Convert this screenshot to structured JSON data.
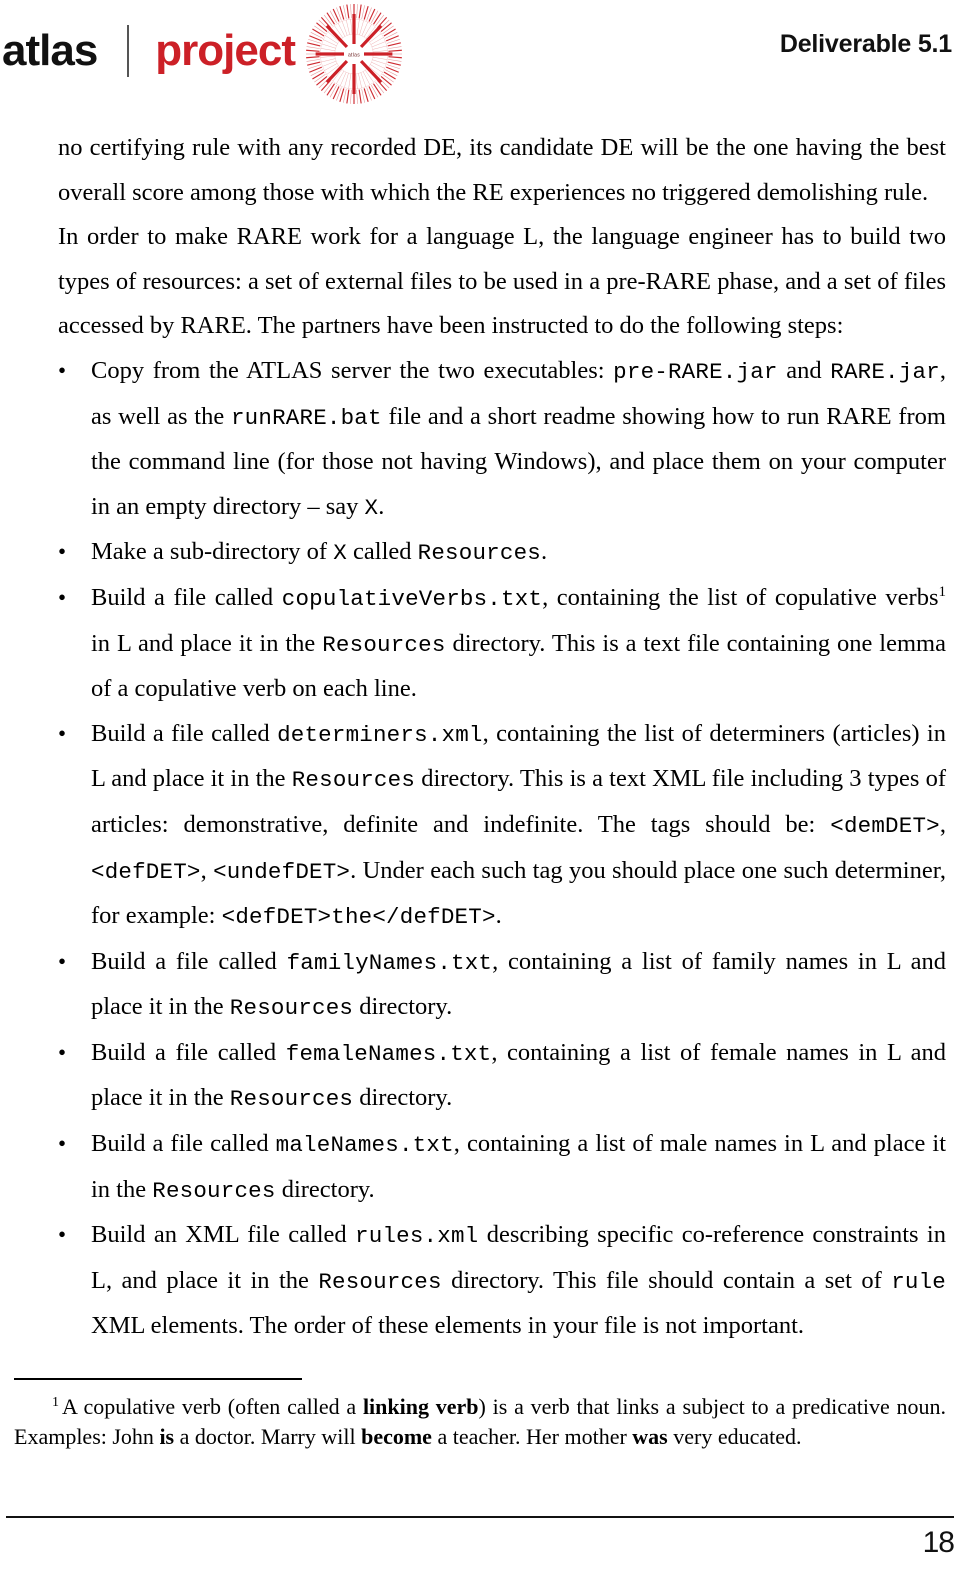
{
  "header": {
    "brand_atlas": "atlas",
    "brand_project": "project",
    "brand_mark_name": "atlas-radial-burst-logo",
    "brand_mark_center_text": "atlas",
    "deliverable": "Deliverable 5.1",
    "accent_red": "#cc2027",
    "text_black": "#111111"
  },
  "body": {
    "paragraph_continued": {
      "part1": "no certifying rule with any recorded DE, its candidate DE will be the one having the best overall score among those with which the RE experiences no triggered demolishing rule."
    },
    "paragraph_rare": {
      "part1": "In order to make RARE work for a language L, the language engineer has to build two types of resources: a set of external files to be used in a pre-RARE phase, and a set of files accessed by RARE. The partners have been instructed to do the following steps:"
    },
    "bullet_glyph": "•",
    "bullets": [
      {
        "name": "copy-executables",
        "segments": [
          {
            "type": "text",
            "value": "Copy from the ATLAS server the two executables: "
          },
          {
            "type": "mono",
            "value": "pre-RARE.jar"
          },
          {
            "type": "text",
            "value": " and "
          },
          {
            "type": "mono",
            "value": "RARE.jar"
          },
          {
            "type": "text",
            "value": ", as well as the "
          },
          {
            "type": "mono",
            "value": "runRARE.bat"
          },
          {
            "type": "text",
            "value": " file and a short readme showing how to run RARE from the command line (for those not having Windows), and place them on your computer in an empty directory – say "
          },
          {
            "type": "mono",
            "value": "X"
          },
          {
            "type": "text",
            "value": "."
          }
        ]
      },
      {
        "name": "make-resources-subdirectory",
        "segments": [
          {
            "type": "text",
            "value": "Make a sub-directory of "
          },
          {
            "type": "mono",
            "value": "X"
          },
          {
            "type": "text",
            "value": " called "
          },
          {
            "type": "mono",
            "value": "Resources"
          },
          {
            "type": "text",
            "value": "."
          }
        ]
      },
      {
        "name": "build-copulative-verbs-file",
        "segments": [
          {
            "type": "text",
            "value": "Build a file called "
          },
          {
            "type": "mono",
            "value": "copulativeVerbs.txt"
          },
          {
            "type": "text",
            "value": ", containing the list of copulative verbs"
          },
          {
            "type": "sup",
            "value": "1"
          },
          {
            "type": "text",
            "value": " in L and place it in the "
          },
          {
            "type": "mono",
            "value": "Resources"
          },
          {
            "type": "text",
            "value": " directory. This is a text file containing one lemma of a copulative verb on each line."
          }
        ]
      },
      {
        "name": "build-determiners-file",
        "segments": [
          {
            "type": "text",
            "value": "Build a file called "
          },
          {
            "type": "mono",
            "value": "determiners.xml"
          },
          {
            "type": "text",
            "value": ", containing the list of determiners (articles) in L and place it in the "
          },
          {
            "type": "mono",
            "value": "Resources"
          },
          {
            "type": "text",
            "value": " directory. This is a text XML file including 3 types of articles: demonstrative, definite and indefinite. The tags should be: "
          },
          {
            "type": "mono",
            "value": "<demDET>"
          },
          {
            "type": "text",
            "value": ", "
          },
          {
            "type": "mono",
            "value": "<defDET>"
          },
          {
            "type": "text",
            "value": ", "
          },
          {
            "type": "mono",
            "value": "<undefDET>"
          },
          {
            "type": "text",
            "value": ". Under each such tag you should place one such determiner, for example: "
          },
          {
            "type": "mono",
            "value": "<defDET>the</defDET>"
          },
          {
            "type": "text",
            "value": "."
          }
        ]
      },
      {
        "name": "build-family-names-file",
        "segments": [
          {
            "type": "text",
            "value": "Build a file called "
          },
          {
            "type": "mono",
            "value": "familyNames.txt"
          },
          {
            "type": "text",
            "value": ", containing a list of family names in L and place it in the "
          },
          {
            "type": "mono",
            "value": "Resources"
          },
          {
            "type": "text",
            "value": " directory."
          }
        ]
      },
      {
        "name": "build-female-names-file",
        "segments": [
          {
            "type": "text",
            "value": "Build a file called "
          },
          {
            "type": "mono",
            "value": "femaleNames.txt"
          },
          {
            "type": "text",
            "value": ", containing a list of female names in L and place it in the "
          },
          {
            "type": "mono",
            "value": "Resources"
          },
          {
            "type": "text",
            "value": " directory."
          }
        ]
      },
      {
        "name": "build-male-names-file",
        "segments": [
          {
            "type": "text",
            "value": "Build a file called "
          },
          {
            "type": "mono",
            "value": "maleNames.txt"
          },
          {
            "type": "text",
            "value": ", containing a list of male names in L and place it in the "
          },
          {
            "type": "mono",
            "value": "Resources"
          },
          {
            "type": "text",
            "value": " directory."
          }
        ]
      },
      {
        "name": "build-rules-xml-file",
        "segments": [
          {
            "type": "text",
            "value": "Build an XML file called "
          },
          {
            "type": "mono",
            "value": "rules.xml"
          },
          {
            "type": "text",
            "value": " describing specific co-reference constraints in L, and place it in the "
          },
          {
            "type": "mono",
            "value": "Resources"
          },
          {
            "type": "text",
            "value": " directory. This file should contain a set of "
          },
          {
            "type": "mono",
            "value": "rule"
          },
          {
            "type": "text",
            "value": " XML elements. The order of these elements in your file is not important."
          }
        ]
      }
    ]
  },
  "footnote": {
    "number": "1",
    "segments": [
      {
        "type": "text",
        "value": "A copulative verb (often called a "
      },
      {
        "type": "bold",
        "value": "linking verb"
      },
      {
        "type": "text",
        "value": ") is a verb that links a subject to a predicative noun. Examples: John "
      },
      {
        "type": "bold",
        "value": "is"
      },
      {
        "type": "text",
        "value": " a doctor. Marry will "
      },
      {
        "type": "bold",
        "value": "become"
      },
      {
        "type": "text",
        "value": " a teacher. Her mother "
      },
      {
        "type": "bold",
        "value": "was"
      },
      {
        "type": "text",
        "value": " very educated."
      }
    ]
  },
  "footer": {
    "page_number": "18"
  }
}
